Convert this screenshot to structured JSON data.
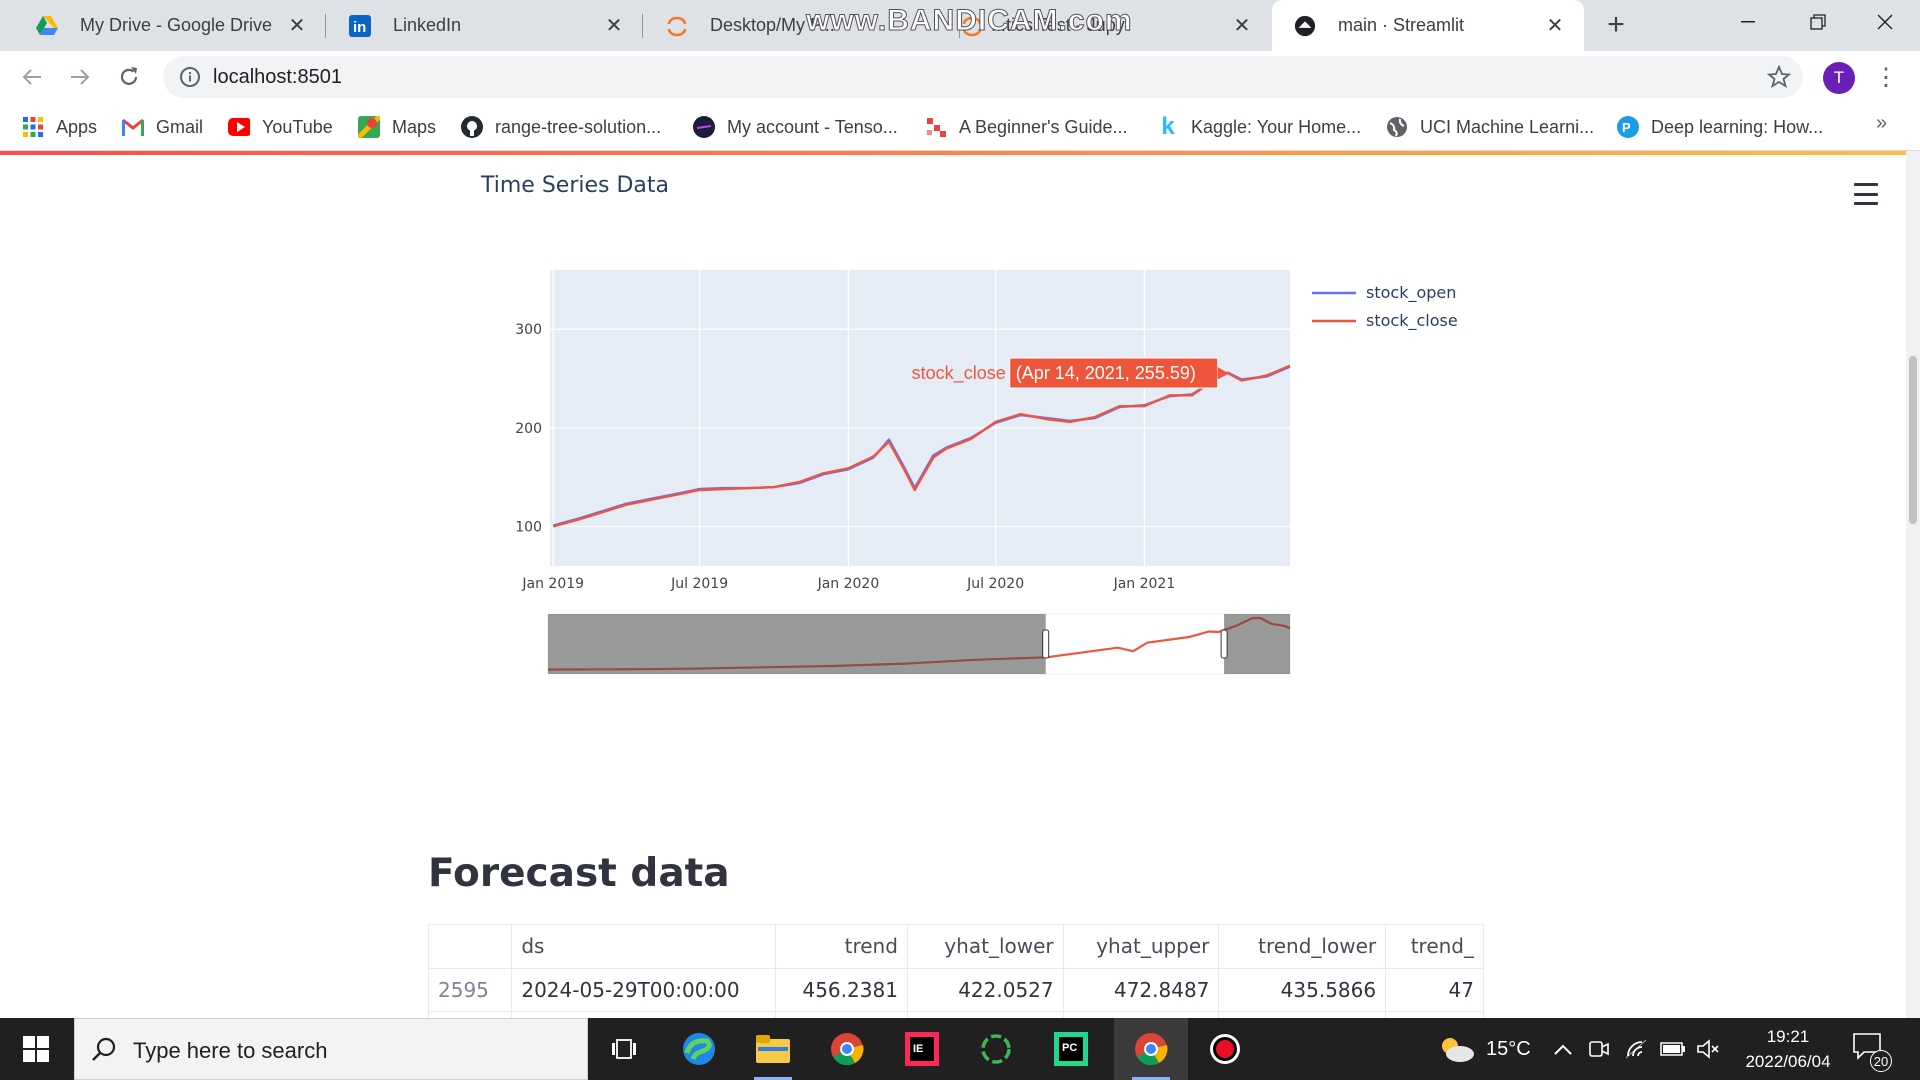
{
  "browser": {
    "tabs": [
      {
        "title": "My Drive - Google Drive",
        "icon": "google-drive-icon"
      },
      {
        "title": "LinkedIn",
        "icon": "linkedin-icon"
      },
      {
        "title": "Desktop/My P...",
        "icon": "jupyter-icon"
      },
      {
        "title": "...tics Test - Jupyt",
        "icon": "jupyter-icon"
      },
      {
        "title": "main · Streamlit",
        "icon": "streamlit-icon",
        "active": true
      }
    ],
    "watermark": "www.BANDICAM.com",
    "url": "localhost:8501",
    "profile_initial": "T",
    "bookmarks": [
      {
        "label": "Apps",
        "icon": "apps-grid-icon"
      },
      {
        "label": "Gmail",
        "icon": "gmail-icon"
      },
      {
        "label": "YouTube",
        "icon": "youtube-icon"
      },
      {
        "label": "Maps",
        "icon": "maps-icon"
      },
      {
        "label": "range-tree-solution...",
        "icon": "github-icon"
      },
      {
        "label": "My account - Tenso...",
        "icon": "tensor-icon"
      },
      {
        "label": "A Beginner's Guide...",
        "icon": "guide-icon"
      },
      {
        "label": "Kaggle: Your Home...",
        "icon": "kaggle-icon"
      },
      {
        "label": "UCI Machine Learni...",
        "icon": "globe-icon"
      },
      {
        "label": "Deep learning: How...",
        "icon": "pyimage-icon"
      }
    ],
    "bookmarks_more": "»"
  },
  "app": {
    "chart_title": "Time Series Data",
    "forecast_heading": "Forecast data",
    "table": {
      "columns": [
        "",
        "ds",
        "trend",
        "yhat_lower",
        "yhat_upper",
        "trend_lower",
        "trend_"
      ],
      "rows": [
        [
          "2595",
          "2024-05-29T00:00:00",
          "456.2381",
          "422.0527",
          "472.8487",
          "435.5866",
          "47"
        ]
      ]
    }
  },
  "chart_data": {
    "type": "line",
    "x_type": "date",
    "xlim": [
      "2018-12-28",
      "2021-06-30"
    ],
    "ylim": [
      60,
      360
    ],
    "yticks": [
      100,
      200,
      300
    ],
    "xticks": [
      "Jan 2019",
      "Jul 2019",
      "Jan 2020",
      "Jul 2020",
      "Jan 2021"
    ],
    "grid": true,
    "legend_position": "top-right",
    "range_slider": {
      "shown": true,
      "full_range": [
        "2012-01-01",
        "2022-06-03"
      ],
      "selected": [
        "2018-12-28",
        "2021-06-30"
      ]
    },
    "hover_label": {
      "series": "stock_close",
      "text": "(Apr 14, 2021, 255.59)",
      "x": "2021-04-14",
      "y": 255.59
    },
    "x": [
      "2019-01-01",
      "2019-02-01",
      "2019-03-01",
      "2019-04-01",
      "2019-05-01",
      "2019-06-01",
      "2019-07-01",
      "2019-08-01",
      "2019-09-01",
      "2019-10-01",
      "2019-11-01",
      "2019-12-01",
      "2020-01-01",
      "2020-02-01",
      "2020-02-20",
      "2020-03-10",
      "2020-03-23",
      "2020-04-15",
      "2020-05-01",
      "2020-06-01",
      "2020-07-01",
      "2020-08-01",
      "2020-09-01",
      "2020-10-01",
      "2020-11-01",
      "2020-12-01",
      "2021-01-01",
      "2021-02-01",
      "2021-03-01",
      "2021-04-01",
      "2021-04-14",
      "2021-05-01",
      "2021-06-01",
      "2021-06-30"
    ],
    "series": [
      {
        "name": "stock_open",
        "color": "#636efa",
        "values": [
          101,
          108,
          115,
          123,
          128,
          133,
          138,
          139,
          139,
          140,
          144,
          153,
          158,
          170,
          188,
          160,
          139,
          172,
          180,
          190,
          205,
          213,
          210,
          207,
          210,
          221,
          223,
          232,
          234,
          250,
          256,
          249,
          252,
          262
        ]
      },
      {
        "name": "stock_close",
        "color": "#ef553b",
        "values": [
          100,
          107,
          114,
          122,
          127,
          132,
          137,
          138,
          139,
          140,
          145,
          154,
          159,
          171,
          186,
          158,
          137,
          170,
          179,
          189,
          206,
          214,
          209,
          206,
          211,
          222,
          222,
          233,
          233,
          251,
          255.59,
          248,
          253,
          263
        ]
      }
    ],
    "slider_series": {
      "name": "stock_close",
      "x": [
        "2012-01-01",
        "2013-01-01",
        "2014-01-01",
        "2015-01-01",
        "2016-01-01",
        "2017-01-01",
        "2018-01-01",
        "2019-01-01",
        "2020-01-01",
        "2020-03-20",
        "2020-06-01",
        "2021-01-01",
        "2021-04-14",
        "2021-06-01",
        "2021-09-01",
        "2021-11-20",
        "2022-01-01",
        "2022-03-01",
        "2022-05-01",
        "2022-06-03"
      ],
      "values": [
        27,
        28,
        32,
        40,
        48,
        62,
        85,
        100,
        158,
        137,
        188,
        222,
        255,
        252,
        290,
        335,
        336,
        300,
        290,
        275
      ]
    }
  },
  "taskbar": {
    "search_placeholder": "Type here to search",
    "apps": [
      "task-view-icon",
      "edge-icon",
      "file-explorer-icon",
      "chrome-icon",
      "intellij-icon",
      "cortana-icon",
      "pycharm-icon",
      "chrome-icon",
      "bandicam-record-icon"
    ],
    "weather": "15°C",
    "time": "19:21",
    "date": "2022/06/04",
    "notifications": "20"
  }
}
